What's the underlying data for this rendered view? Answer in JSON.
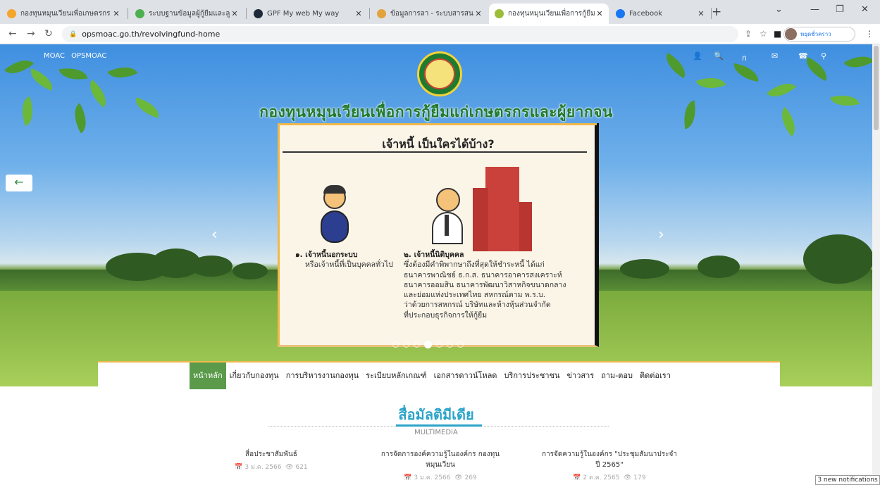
{
  "tabs": [
    {
      "label": "กองทุนหมุนเวียนเพื่อเกษตรกร",
      "color": "#f4a52a"
    },
    {
      "label": "ระบบฐานข้อมูลผู้กู้ยืมและลูกหนี้",
      "color": "#4caf50"
    },
    {
      "label": "GPF My web My way",
      "color": "#1e2a3a"
    },
    {
      "label": "ข้อมูลการลา - ระบบสารสนเทศ",
      "color": "#e4a33a"
    },
    {
      "label": "กองทุนหมุนเวียนเพื่อการกู้ยืมแก",
      "color": "#9bbd3a"
    },
    {
      "label": "Facebook",
      "color": "#1877f2"
    }
  ],
  "url": "opsmoac.go.th/revolvingfund-home",
  "profile_label": "หยุดชั่วคราว",
  "header": {
    "links": [
      "MOAC",
      "OPSMOAC"
    ],
    "lang": "ก",
    "site_title": "กองทุนหมุนเวียนเพื่อการกู้ยืมแก่เกษตรกรและผู้ยากจน"
  },
  "slide": {
    "heading": "เจ้าหนี้ เป็นใครได้บ้าง?",
    "item1_title": "๑. เจ้าหนี้นอกระบบ",
    "item1_text": "หรือเจ้าหนี้ที่เป็นบุคคลทั่วไป",
    "item2_title": "๒. เจ้าหนี้นิติบุคคล",
    "item2_lines": [
      "ซึ่งต้องมีคำพิพากษาถึงที่สุดให้ชำระหนี้ ได้แก่",
      "ธนาคารพาณิชย์ ธ.ก.ส. ธนาคารอาคารสงเคราะห์",
      "ธนาคารออมสิน ธนาคารพัฒนาวิสาหกิจขนาดกลาง",
      "และย่อมแห่งประเทศไทย สหกรณ์ตาม พ.ร.บ.",
      "ว่าด้วยการสหกรณ์ บริษัทและห้างหุ้นส่วนจำกัด",
      "ที่ประกอบธุรกิจการให้กู้ยืม"
    ]
  },
  "menu": [
    "หน้าหลัก",
    "เกี่ยวกับกองทุน",
    "การบริหารงานกองทุน",
    "ระเบียบหลักเกณฑ์",
    "เอกสารดาวน์โหลด",
    "บริการประชาชน",
    "ข่าวสาร",
    "ถาม-ตอบ",
    "ติดต่อเรา"
  ],
  "multimedia": {
    "title": "สื่อมัลติมีเดีย",
    "subtitle": "MULTIMEDIA",
    "items": [
      {
        "title_lines": [
          "สื่อประชาสัมพันธ์"
        ],
        "date": "3 ม.ค. 2566",
        "views": "621"
      },
      {
        "title_lines": [
          "การจัดการองค์ความรู้ในองค์กร กองทุน",
          "หมุนเวียน"
        ],
        "date": "3 ม.ค. 2566",
        "views": "269"
      },
      {
        "title_lines": [
          "การจัดความรู้ในองค์กร \"ประชุมสัมนาประจำ",
          "ปี 2565\""
        ],
        "date": "2 ต.ค. 2565",
        "views": "179"
      }
    ]
  },
  "notification": "3 new notifications"
}
